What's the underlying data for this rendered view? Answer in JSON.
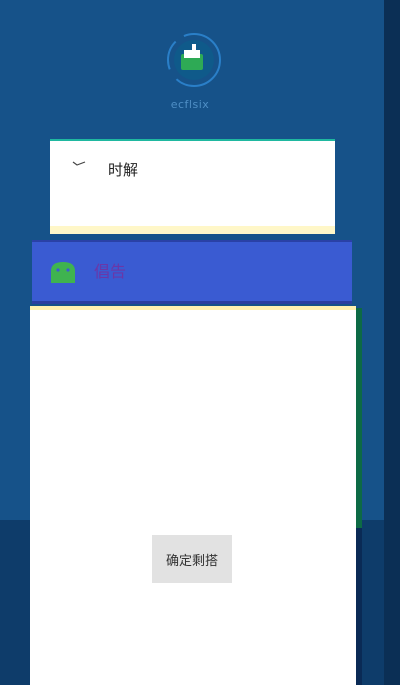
{
  "header": {
    "logo_caption": "ecflsix"
  },
  "top_card": {
    "label": "时解"
  },
  "tabbar": {
    "label": "倡告"
  },
  "panel": {
    "confirm_label": "确定剩搭"
  },
  "colors": {
    "background": "#165289",
    "tabbar": "#3a5bd2",
    "tab_label": "#6a37a8",
    "card_accent": "#1fb8a0"
  }
}
